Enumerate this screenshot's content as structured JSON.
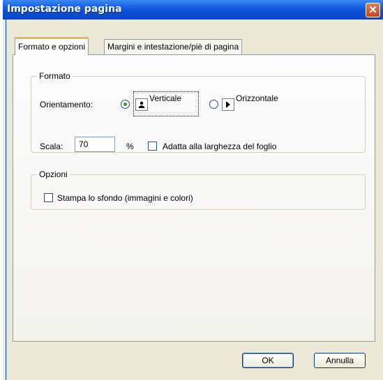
{
  "window": {
    "title": "Impostazione pagina",
    "close_glyph": "✕"
  },
  "tabs": [
    {
      "label": "Formato e opzioni",
      "active": true
    },
    {
      "label": "Margini e intestazione/piè di pagina",
      "active": false
    }
  ],
  "formato": {
    "legend": "Formato",
    "orientation_label": "Orientamento:",
    "portrait_label": "Verticale",
    "landscape_label": "Orizzontale",
    "selected": "Verticale",
    "scale_label": "Scala:",
    "scale_value": "70",
    "percent": "%",
    "fit_label": "Adatta alla larghezza del foglio",
    "fit_checked": false
  },
  "opzioni": {
    "legend": "Opzioni",
    "print_bg_label": "Stampa lo sfondo (immagini e colori)",
    "print_bg_checked": false
  },
  "footer": {
    "ok_label": "OK",
    "cancel_label": "Annulla"
  }
}
